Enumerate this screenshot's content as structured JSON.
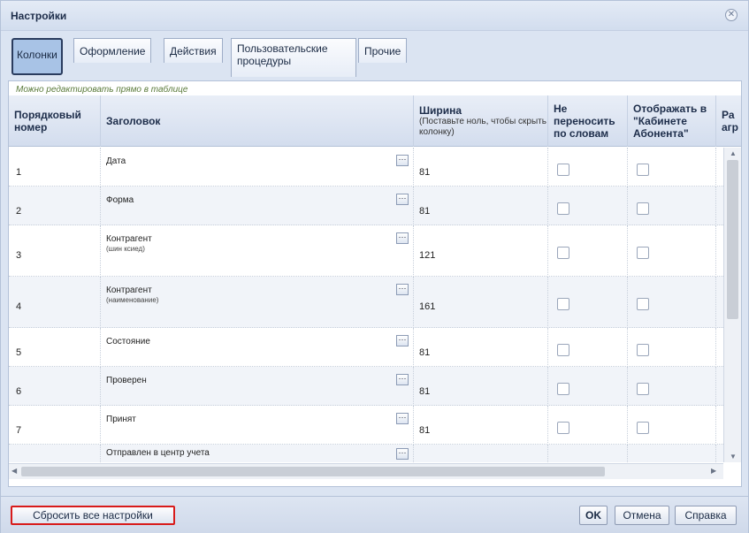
{
  "dialog": {
    "title": "Настройки"
  },
  "tabs": [
    {
      "label": "Колонки",
      "active": true
    },
    {
      "label": "Оформление"
    },
    {
      "label": "Действия"
    },
    {
      "label": "Пользовательские процедуры"
    },
    {
      "label": "Прочие"
    }
  ],
  "hint": "Можно редактировать прямо в таблице",
  "columns": [
    {
      "label": "Порядковый номер"
    },
    {
      "label": "Заголовок"
    },
    {
      "label": "Ширина",
      "sub": "(Поставьте ноль, чтобы скрыть колонку)"
    },
    {
      "label": "Не переносить по словам"
    },
    {
      "label": "Отображать в \"Кабинете Абонента\""
    },
    {
      "label": "Ра агр"
    }
  ],
  "rows": [
    {
      "num": "1",
      "title": "Дата",
      "subtitle": "",
      "width": "81"
    },
    {
      "num": "2",
      "title": "Форма",
      "subtitle": "",
      "width": "81"
    },
    {
      "num": "3",
      "title": "Контрагент",
      "subtitle": "(шин ксиед)",
      "width": "121"
    },
    {
      "num": "4",
      "title": "Контрагент",
      "subtitle": "(наименование)",
      "width": "161"
    },
    {
      "num": "5",
      "title": "Состояние",
      "subtitle": "",
      "width": "81"
    },
    {
      "num": "6",
      "title": "Проверен",
      "subtitle": "",
      "width": "81"
    },
    {
      "num": "7",
      "title": "Принят",
      "subtitle": "",
      "width": "81"
    },
    {
      "num": "",
      "title": "Отправлен в центр учета",
      "subtitle": "",
      "width": ""
    }
  ],
  "buttons": {
    "reset": "Сбросить все настройки",
    "ok": "OK",
    "cancel": "Отмена",
    "help": "Справка"
  }
}
